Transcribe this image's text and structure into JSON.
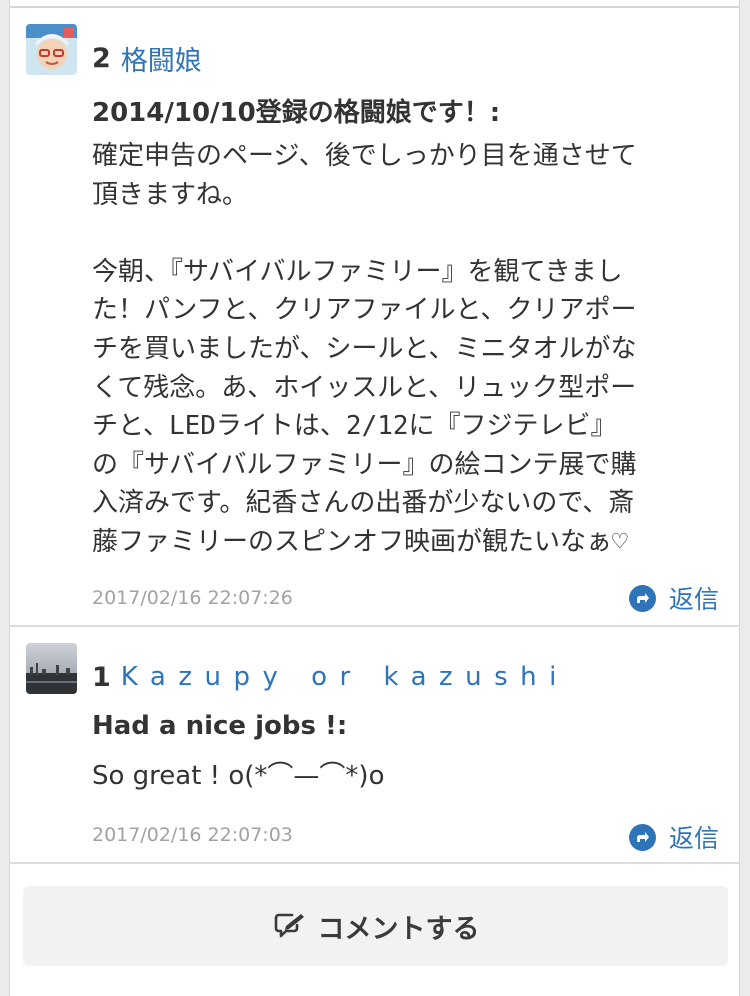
{
  "comments": [
    {
      "number": "2",
      "username": "格闘娘",
      "title": "2014/10/10登録の格闘娘です！:",
      "body": "確定申告のページ、後でしっかり目を通させて\n頂きますね。\n\n今朝、『サバイバルファミリー』を観てきまし\nた！パンフと、クリアファイルと、クリアポー\nチを買いましたが、シールと、ミニタオルがな\nくて残念。あ、ホイッスルと、リュック型ポー\nチと、LEDライトは、2/12に『フジテレビ』\nの『サバイバルファミリー』の絵コンテ展で購\n入済みです。紀香さんの出番が少ないので、斎\n藤ファミリーのスピンオフ映画が観たいなぁ♡",
      "timestamp": "2017/02/16 22:07:26",
      "reply_label": "返信"
    },
    {
      "number": "1",
      "username": "Kazupy or kazushi",
      "title": "Had a nice jobs !:",
      "body": "So great ! o(*⌒—⌒*)o",
      "timestamp": "2017/02/16 22:07:03",
      "reply_label": "返信"
    }
  ],
  "comment_button": {
    "label": "コメントする",
    "icon": "comment-edit-icon"
  },
  "colors": {
    "accent": "#2f74b8",
    "text": "#333333",
    "muted": "#a2a2a2",
    "button_bg": "#f2f2f2"
  }
}
